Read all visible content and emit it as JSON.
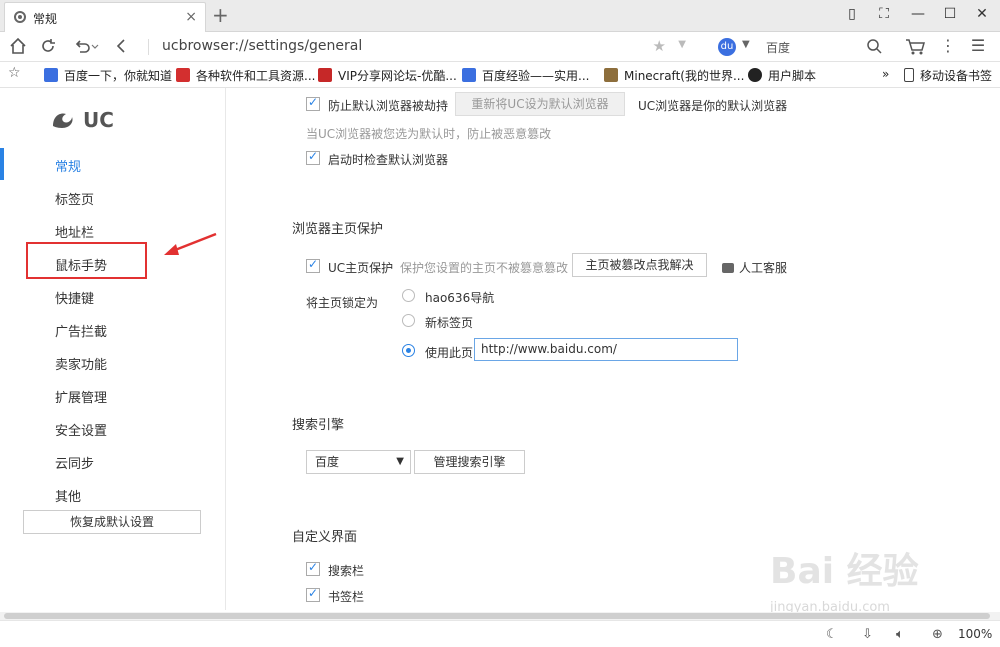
{
  "tab": {
    "title": "常规",
    "close": "×"
  },
  "newtab": "+",
  "window_controls": {
    "restore": "▯",
    "skin": "⛶",
    "minimize": "—",
    "maximize": "☐",
    "close": "✕"
  },
  "address": {
    "url": "ucbrowser://settings/general"
  },
  "search": {
    "engine": "百度",
    "logo_text": "du"
  },
  "bookmarks": [
    {
      "label": "百度一下，你就知道",
      "color": "#3b6fe0"
    },
    {
      "label": "各种软件和工具资源...",
      "color": "#d32f2f"
    },
    {
      "label": "VIP分享网论坛-优酷...",
      "color": "#c62828"
    },
    {
      "label": "百度经验——实用...",
      "color": "#3b6fe0"
    },
    {
      "label": "Minecraft(我的世界...",
      "color": "#8d6e3c"
    },
    {
      "label": "用户脚本",
      "color": "#222222"
    }
  ],
  "bookmark_more": "»",
  "mobile_bookmarks": "移动设备书签",
  "sidebar": {
    "logo": "UC",
    "items": [
      {
        "label": "常规"
      },
      {
        "label": "标签页"
      },
      {
        "label": "地址栏"
      },
      {
        "label": "鼠标手势"
      },
      {
        "label": "快捷键"
      },
      {
        "label": "广告拦截"
      },
      {
        "label": "卖家功能"
      },
      {
        "label": "扩展管理"
      },
      {
        "label": "安全设置"
      },
      {
        "label": "云同步"
      },
      {
        "label": "其他"
      }
    ],
    "reset_button": "恢复成默认设置"
  },
  "default_browser": {
    "prevent_hijack": "防止默认浏览器被劫持",
    "reset_button": "重新将UC设为默认浏览器",
    "status": "UC浏览器是你的默认浏览器",
    "hint": "当UC浏览器被您选为默认时，防止被恶意篡改",
    "check_on_start": "启动时检查默认浏览器"
  },
  "homepage": {
    "title": "浏览器主页保护",
    "uc_protect": "UC主页保护",
    "hint": "保护您设置的主页不被篡意篡改",
    "fix_button": "主页被篡改点我解决",
    "support": "人工客服",
    "lock_label": "将主页锁定为",
    "options": [
      "hao636导航",
      "新标签页",
      "使用此页"
    ],
    "custom_url": "http://www.baidu.com/"
  },
  "search_engine": {
    "title": "搜索引擎",
    "selected": "百度",
    "manage_button": "管理搜索引擎"
  },
  "custom_ui": {
    "title": "自定义界面",
    "items": [
      "搜索栏",
      "书签栏"
    ]
  },
  "status": {
    "zoom": "100%"
  },
  "watermark": {
    "text": "Bai 经验",
    "sub": "jingyan.baidu.com"
  },
  "colors": {
    "accent": "#2a82e4",
    "annotation": "#e23131"
  }
}
